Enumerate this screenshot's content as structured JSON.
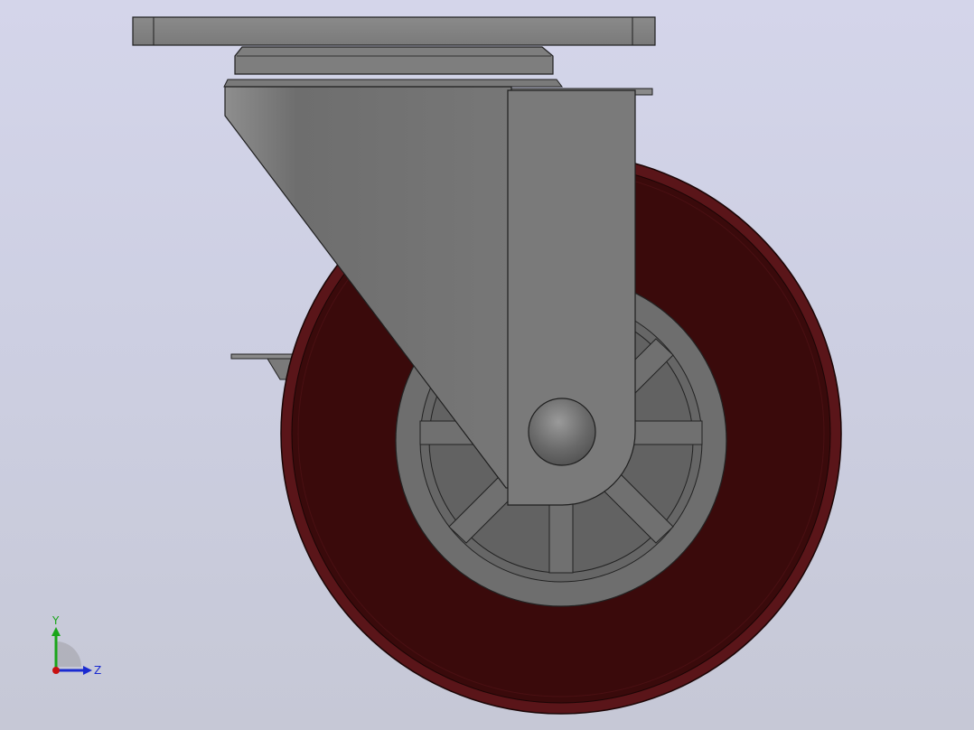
{
  "viewport": {
    "background_top": "#d4d5ea",
    "background_bottom": "#c6c8d6"
  },
  "model": {
    "parts": [
      "mounting-plate",
      "swivel-bearing",
      "fork-bracket",
      "wheel-tread",
      "wheel-hub",
      "axle-cap",
      "brake-lever"
    ],
    "colors": {
      "metal": "#7c7c7c",
      "metal_dark": "#5e5e5e",
      "tread": "#3a0a0b",
      "tread_rim": "#5a1519",
      "hub": "#6c6c6c"
    }
  },
  "triad": {
    "y_label": "Y",
    "z_label": "Z",
    "y_color": "#1aa51a",
    "z_color": "#1a2ad0",
    "x_color": "#c81010"
  }
}
